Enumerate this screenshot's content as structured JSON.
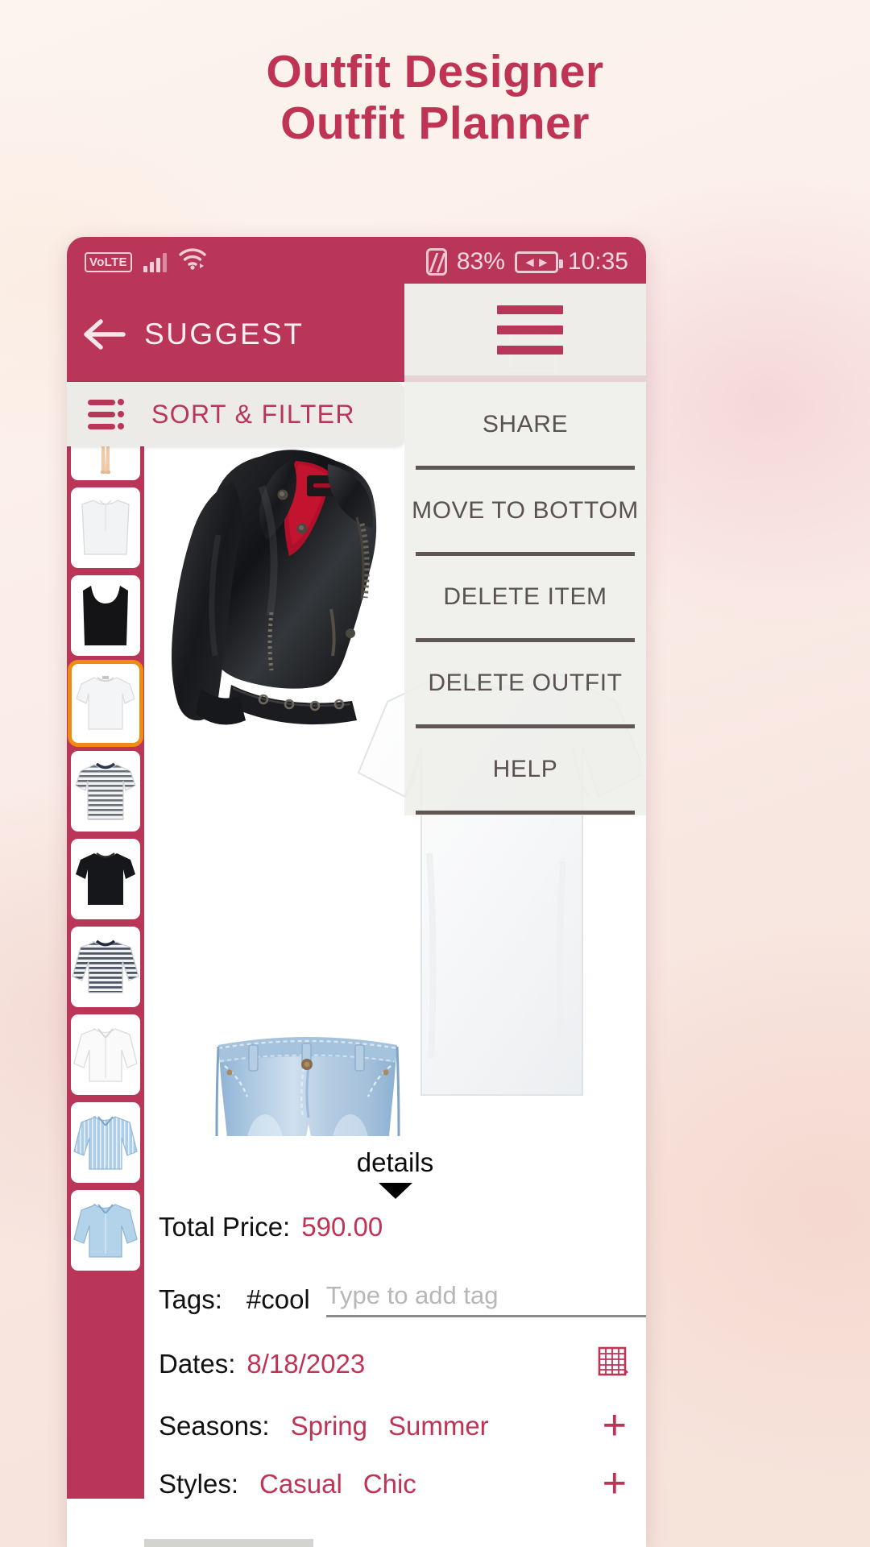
{
  "promo": {
    "line1": "Outfit Designer",
    "line2": "Outfit Planner",
    "color": "#bf3455"
  },
  "statusbar": {
    "volte": "VoLTE",
    "signal_icon": "signal-bars-icon",
    "wifi_icon": "wifi-icon",
    "nfc_icon": "nfc-icon",
    "battery_percent": "83%",
    "battery_icon": "battery-charging-icon",
    "time": "10:35"
  },
  "appbar": {
    "back_icon": "back-arrow-icon",
    "title": "SUGGEST",
    "brand_icon": "hat-hanger-calendar-icon",
    "menu_icon": "hamburger-menu-icon",
    "background": "#b93659"
  },
  "sortbar": {
    "icon": "sort-filter-icon",
    "label": "SORT & FILTER"
  },
  "overflow_menu": {
    "items": [
      {
        "label": "SHARE"
      },
      {
        "label": "MOVE TO BOTTOM"
      },
      {
        "label": "DELETE ITEM"
      },
      {
        "label": "DELETE OUTFIT"
      },
      {
        "label": "HELP"
      }
    ]
  },
  "rail": {
    "items": [
      {
        "name": "mannequin",
        "selected": false
      },
      {
        "name": "white-sleeveless-top",
        "selected": false
      },
      {
        "name": "black-tank-top",
        "selected": false
      },
      {
        "name": "white-t-shirt",
        "selected": true
      },
      {
        "name": "striped-tee",
        "selected": false
      },
      {
        "name": "black-t-shirt",
        "selected": false
      },
      {
        "name": "striped-long-sleeve",
        "selected": false
      },
      {
        "name": "white-blouse",
        "selected": false
      },
      {
        "name": "blue-striped-shirt",
        "selected": false
      },
      {
        "name": "light-blue-shirt",
        "selected": false
      }
    ],
    "selected_border_color": "#f08a12",
    "background": "#b93659"
  },
  "canvas": {
    "garments": [
      {
        "name": "black-leather-jacket"
      },
      {
        "name": "light-blue-jeans"
      },
      {
        "name": "white-t-shirt"
      }
    ]
  },
  "details": {
    "toggle_label": "details",
    "toggle_icon": "chevron-down-icon",
    "total_price_label": "Total Price:",
    "total_price_value": "590.00",
    "tags_label": "Tags:",
    "tags_values": [
      "#cool"
    ],
    "tags_placeholder": "Type to add tag",
    "dates_label": "Dates:",
    "dates_value": "8/18/2023",
    "calendar_icon": "calendar-icon",
    "seasons_label": "Seasons:",
    "seasons_values": [
      "Spring",
      "Summer"
    ],
    "seasons_add_icon": "plus-icon",
    "styles_label": "Styles:",
    "styles_values": [
      "Casual",
      "Chic"
    ],
    "styles_add_icon": "plus-icon",
    "accent_color": "#bf3455"
  }
}
